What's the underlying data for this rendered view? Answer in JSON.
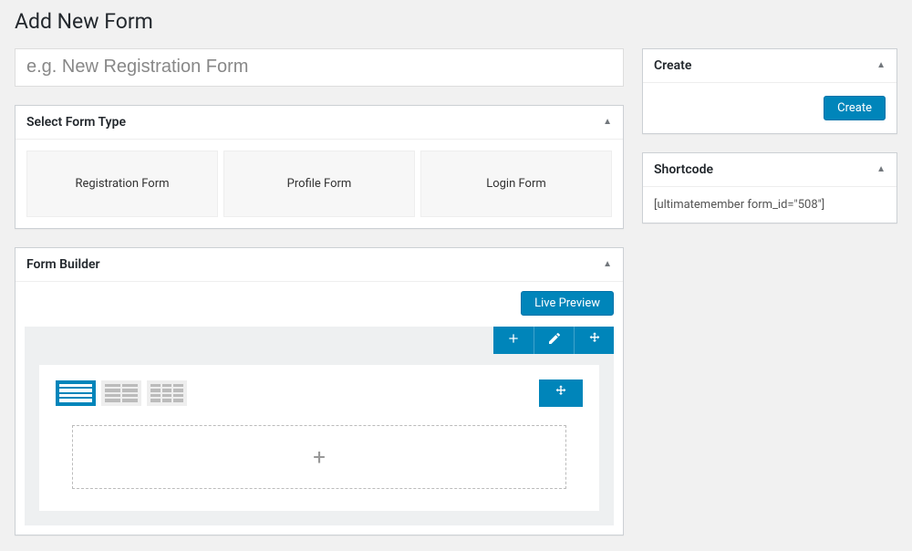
{
  "page": {
    "title": "Add New Form"
  },
  "title_input": {
    "placeholder": "e.g. New Registration Form",
    "value": ""
  },
  "form_type_panel": {
    "title": "Select Form Type",
    "options": [
      "Registration Form",
      "Profile Form",
      "Login Form"
    ]
  },
  "form_builder_panel": {
    "title": "Form Builder",
    "live_preview_label": "Live Preview",
    "add_field_glyph": "+"
  },
  "create_panel": {
    "title": "Create",
    "button_label": "Create"
  },
  "shortcode_panel": {
    "title": "Shortcode",
    "value": "[ultimatemember form_id=\"508\"]"
  }
}
